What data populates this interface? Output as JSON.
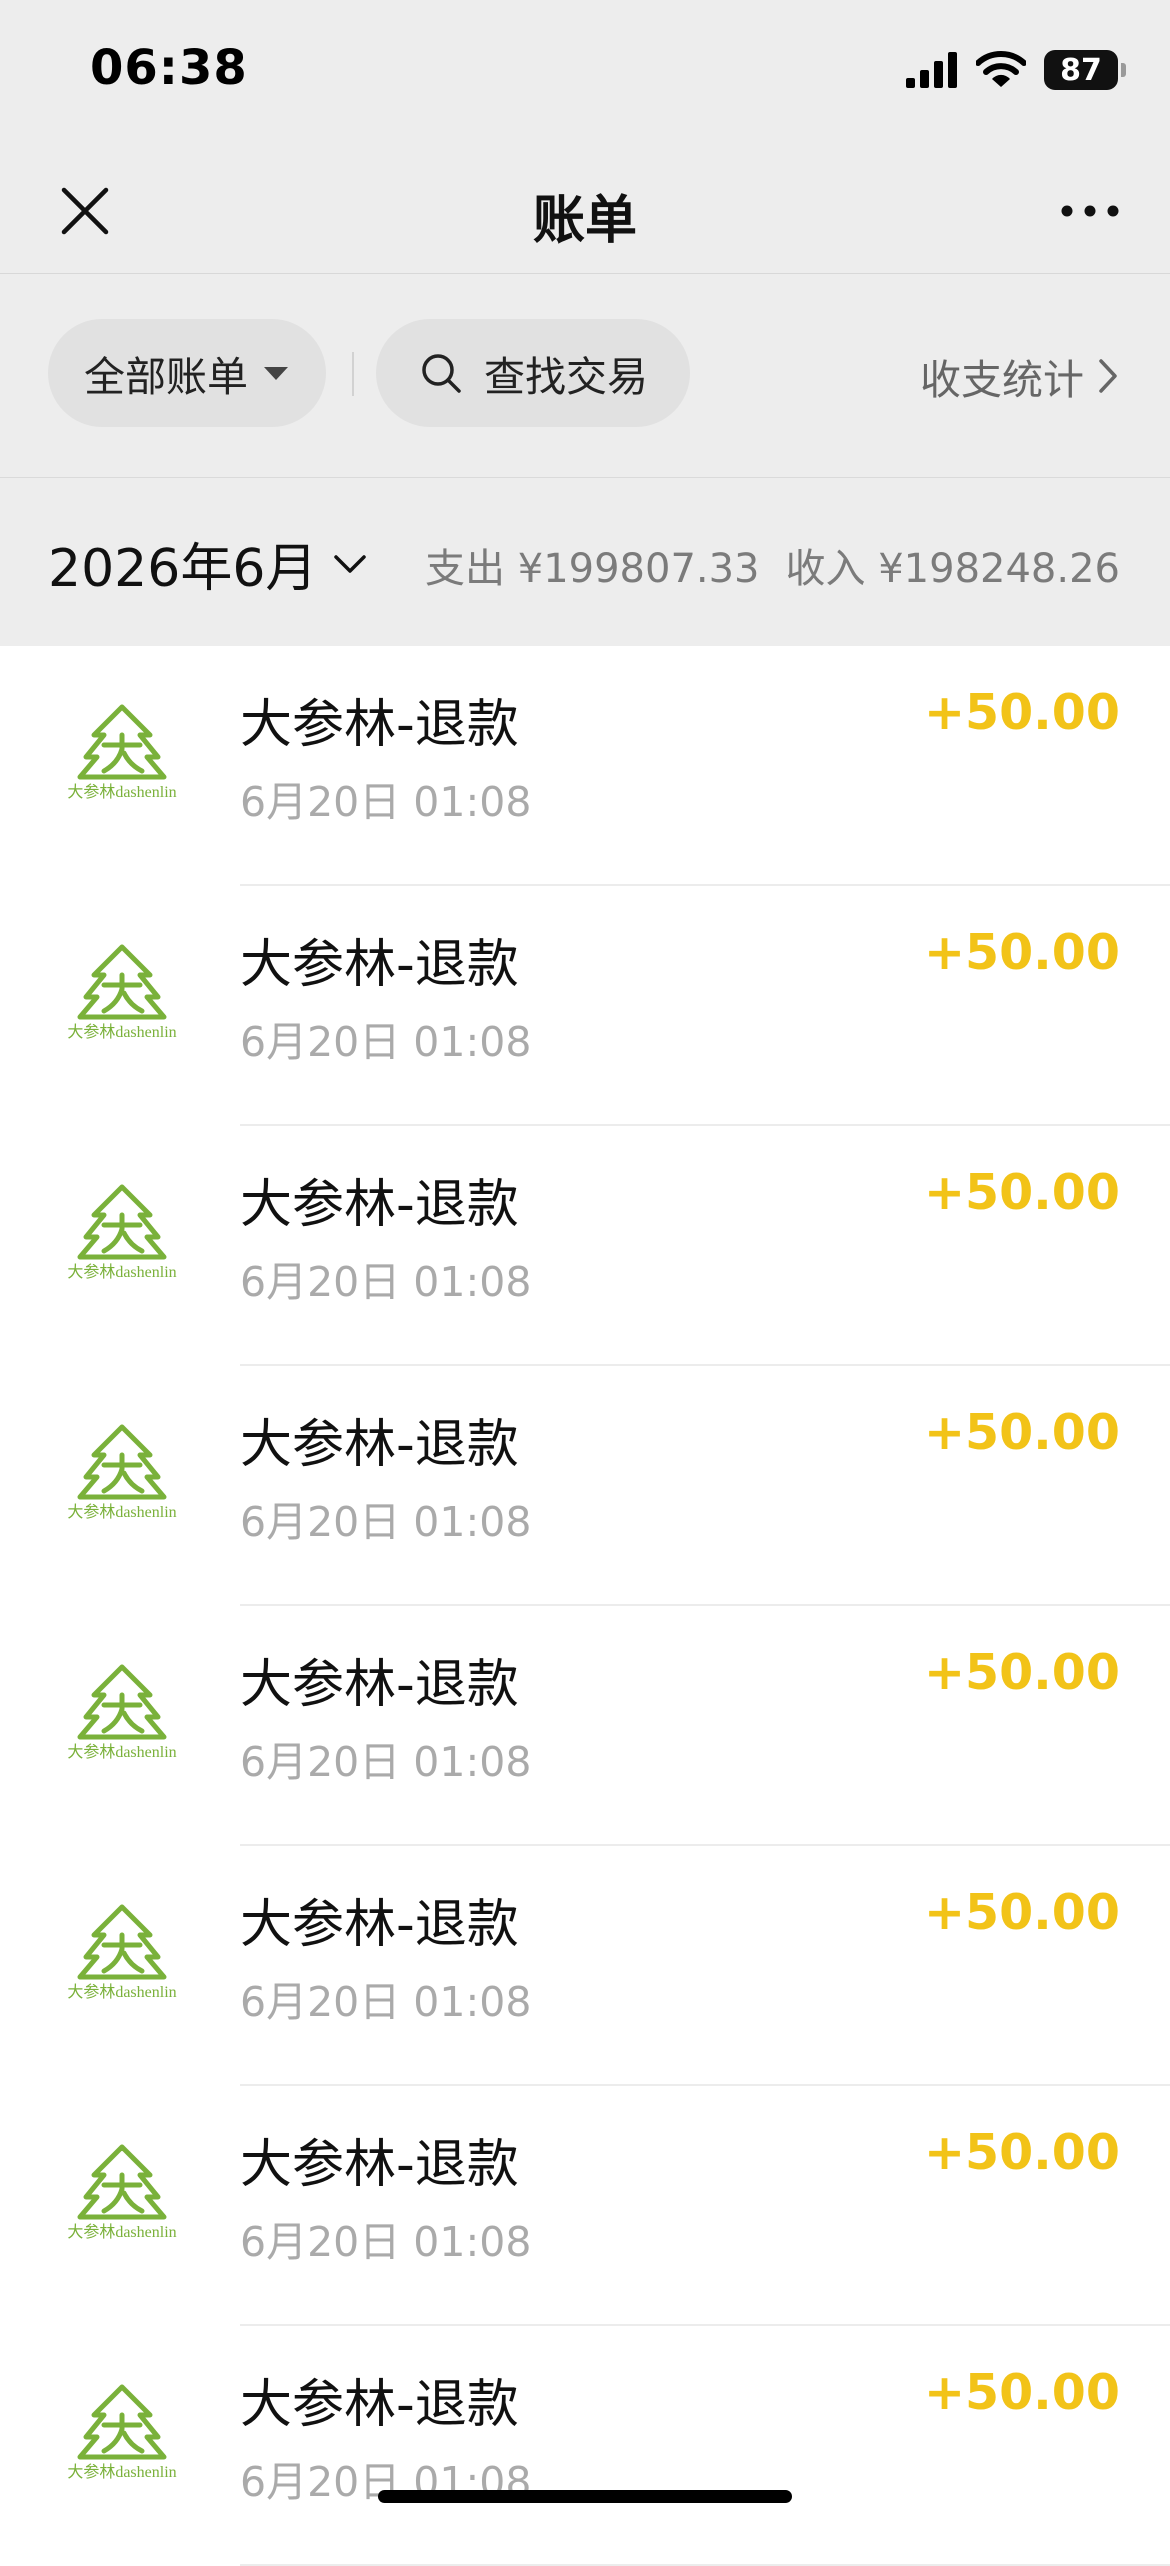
{
  "status_bar": {
    "time": "06:38",
    "battery": "87"
  },
  "nav": {
    "title": "账单",
    "close_icon": "close-icon",
    "more_icon": "more-icon"
  },
  "filters": {
    "all_bills_label": "全部账单",
    "search_label": "查找交易",
    "stats_label": "收支统计"
  },
  "month_bar": {
    "month": "2026年6月",
    "expense": "支出 ¥199807.33",
    "income": "收入 ¥198248.26"
  },
  "colors": {
    "amount": "#f2c318",
    "brand_green": "#7ab13a",
    "background": "#ededed"
  },
  "transactions": [
    {
      "logo_text": "大参林dashenlin",
      "name": "大参林-退款",
      "date": "6月20日 01:08",
      "amount": "+50.00"
    },
    {
      "logo_text": "大参林dashenlin",
      "name": "大参林-退款",
      "date": "6月20日 01:08",
      "amount": "+50.00"
    },
    {
      "logo_text": "大参林dashenlin",
      "name": "大参林-退款",
      "date": "6月20日 01:08",
      "amount": "+50.00"
    },
    {
      "logo_text": "大参林dashenlin",
      "name": "大参林-退款",
      "date": "6月20日 01:08",
      "amount": "+50.00"
    },
    {
      "logo_text": "大参林dashenlin",
      "name": "大参林-退款",
      "date": "6月20日 01:08",
      "amount": "+50.00"
    },
    {
      "logo_text": "大参林dashenlin",
      "name": "大参林-退款",
      "date": "6月20日 01:08",
      "amount": "+50.00"
    },
    {
      "logo_text": "大参林dashenlin",
      "name": "大参林-退款",
      "date": "6月20日 01:08",
      "amount": "+50.00"
    },
    {
      "logo_text": "大参林dashenlin",
      "name": "大参林-退款",
      "date": "6月20日 01:08",
      "amount": "+50.00"
    }
  ]
}
